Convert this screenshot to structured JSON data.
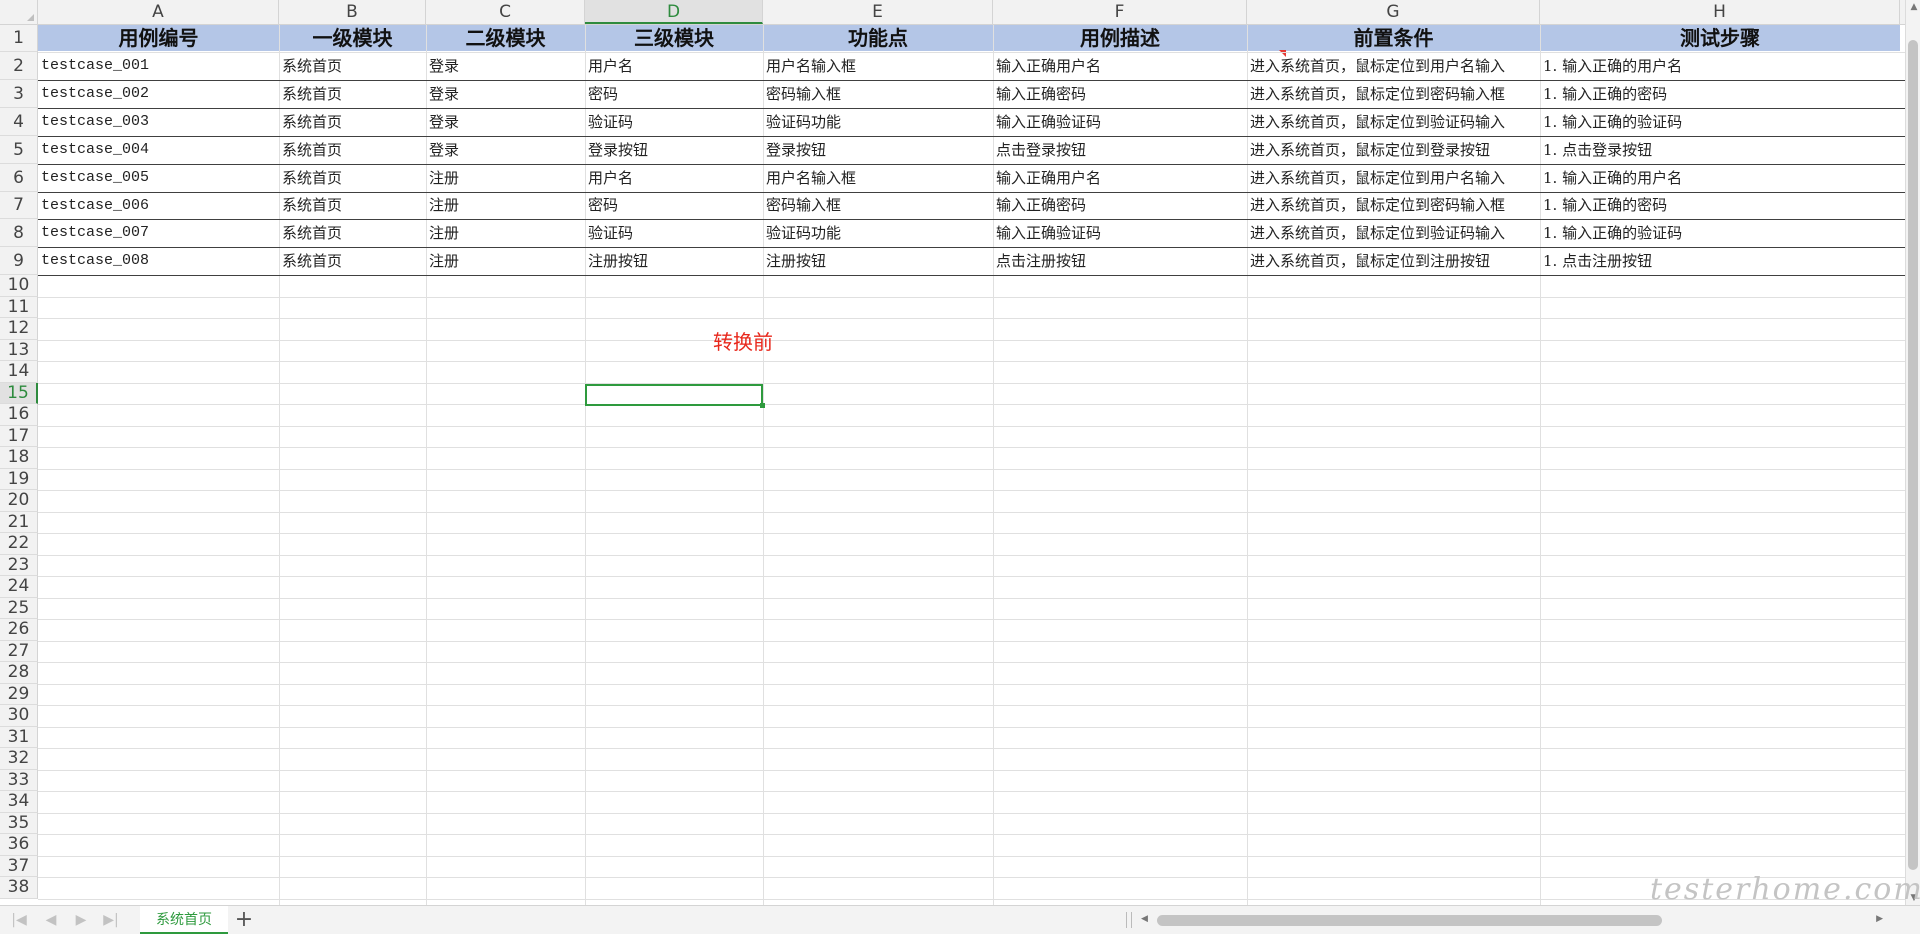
{
  "columns": [
    "A",
    "B",
    "C",
    "D",
    "E",
    "F",
    "G",
    "H"
  ],
  "rows": [
    "1",
    "2",
    "3",
    "4",
    "5",
    "6",
    "7",
    "8",
    "9",
    "10",
    "11",
    "12",
    "13",
    "14",
    "15",
    "16",
    "17",
    "18",
    "19",
    "20",
    "21",
    "22",
    "23",
    "24",
    "25",
    "26",
    "27",
    "28",
    "29",
    "30",
    "31",
    "32",
    "33",
    "34",
    "35",
    "36",
    "37",
    "38"
  ],
  "active_cell": {
    "column": "D",
    "row": "15"
  },
  "table": {
    "headers": [
      "用例编号",
      "一级模块",
      "二级模块",
      "三级模块",
      "功能点",
      "用例描述",
      "前置条件",
      "测试步骤"
    ],
    "rows": [
      [
        "testcase_001",
        "系统首页",
        "登录",
        "用户名",
        "用户名输入框",
        "输入正确用户名",
        "进入系统首页，鼠标定位到用户名输入",
        "1.  输入正确的用户名"
      ],
      [
        "testcase_002",
        "系统首页",
        "登录",
        "密码",
        "密码输入框",
        "输入正确密码",
        "进入系统首页，鼠标定位到密码输入框",
        "1.  输入正确的密码"
      ],
      [
        "testcase_003",
        "系统首页",
        "登录",
        "验证码",
        "验证码功能",
        "输入正确验证码",
        "进入系统首页，鼠标定位到验证码输入",
        "1.  输入正确的验证码"
      ],
      [
        "testcase_004",
        "系统首页",
        "登录",
        "登录按钮",
        "登录按钮",
        "点击登录按钮",
        "进入系统首页，鼠标定位到登录按钮",
        "1.  点击登录按钮"
      ],
      [
        "testcase_005",
        "系统首页",
        "注册",
        "用户名",
        "用户名输入框",
        "输入正确用户名",
        "进入系统首页，鼠标定位到用户名输入",
        "1.  输入正确的用户名"
      ],
      [
        "testcase_006",
        "系统首页",
        "注册",
        "密码",
        "密码输入框",
        "输入正确密码",
        "进入系统首页，鼠标定位到密码输入框",
        "1.  输入正确的密码"
      ],
      [
        "testcase_007",
        "系统首页",
        "注册",
        "验证码",
        "验证码功能",
        "输入正确验证码",
        "进入系统首页，鼠标定位到验证码输入",
        "1.  输入正确的验证码"
      ],
      [
        "testcase_008",
        "系统首页",
        "注册",
        "注册按钮",
        "注册按钮",
        "点击注册按钮",
        "进入系统首页，鼠标定位到注册按钮",
        "1.  点击注册按钮"
      ]
    ]
  },
  "annotation": "转换前",
  "sheet_tab": "系统首页",
  "add_sheet_label": "+",
  "nav_icons": [
    "first-sheet-icon",
    "prev-sheet-icon",
    "next-sheet-icon",
    "last-sheet-icon"
  ],
  "watermark": "testerhome.com",
  "colors": {
    "header_fill": "#b4c6e7",
    "accent_green": "#2e9a3e",
    "annotation_red": "#e8281c"
  }
}
